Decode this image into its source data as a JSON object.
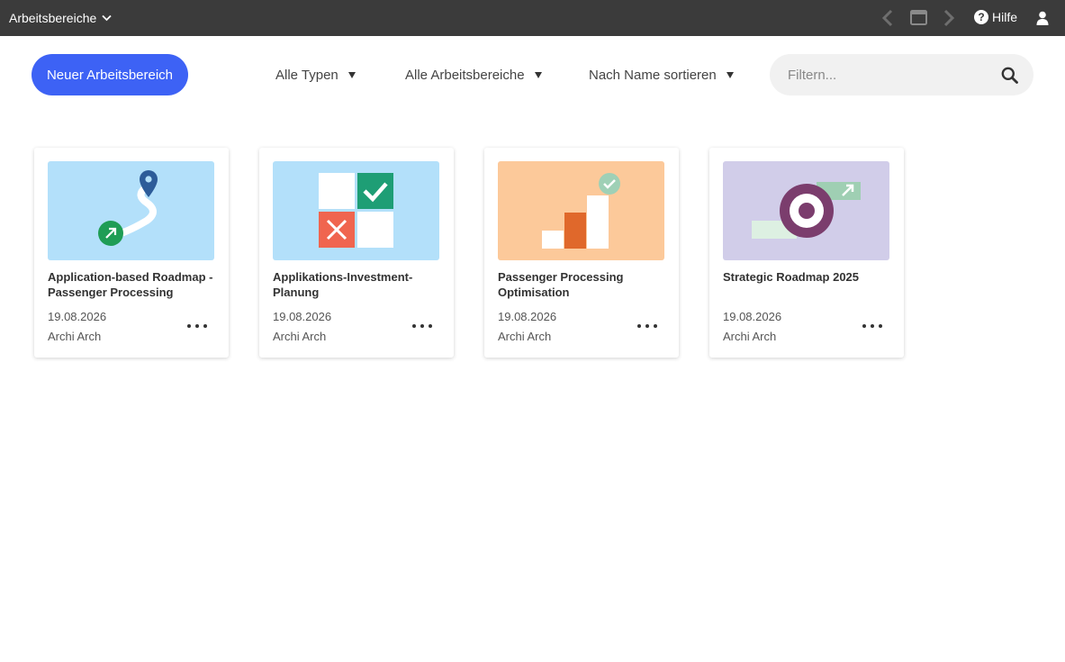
{
  "topbar": {
    "workspace_menu_label": "Arbeitsbereiche",
    "help_label": "Hilfe"
  },
  "toolbar": {
    "new_button_label": "Neuer Arbeitsbereich",
    "filter_type_label": "Alle Typen",
    "filter_workspace_label": "Alle Arbeitsbereiche",
    "sort_label": "Nach Name sortieren",
    "search_placeholder": "Filtern..."
  },
  "cards": [
    {
      "title": "Application-based Roadmap - Passenger Processing",
      "date": "19.08.2026",
      "owner": "Archi Arch",
      "thumbnail": "roadmap-route-icon",
      "thumb_bg": "#b3e0fa"
    },
    {
      "title": "Applikations-Investment-Planung",
      "date": "19.08.2026",
      "owner": "Archi Arch",
      "thumbnail": "investment-grid-icon",
      "thumb_bg": "#b3e0fa"
    },
    {
      "title": "Passenger Processing Optimisation",
      "date": "19.08.2026",
      "owner": "Archi Arch",
      "thumbnail": "bar-growth-icon",
      "thumb_bg": "#fcc99a"
    },
    {
      "title": "Strategic Roadmap 2025",
      "date": "19.08.2026",
      "owner": "Archi Arch",
      "thumbnail": "target-icon",
      "thumb_bg": "#d1cde9"
    }
  ],
  "colors": {
    "topbar_bg": "#3b3b3b",
    "primary_button": "#3d62f5",
    "search_bg": "#f1f1f1"
  }
}
